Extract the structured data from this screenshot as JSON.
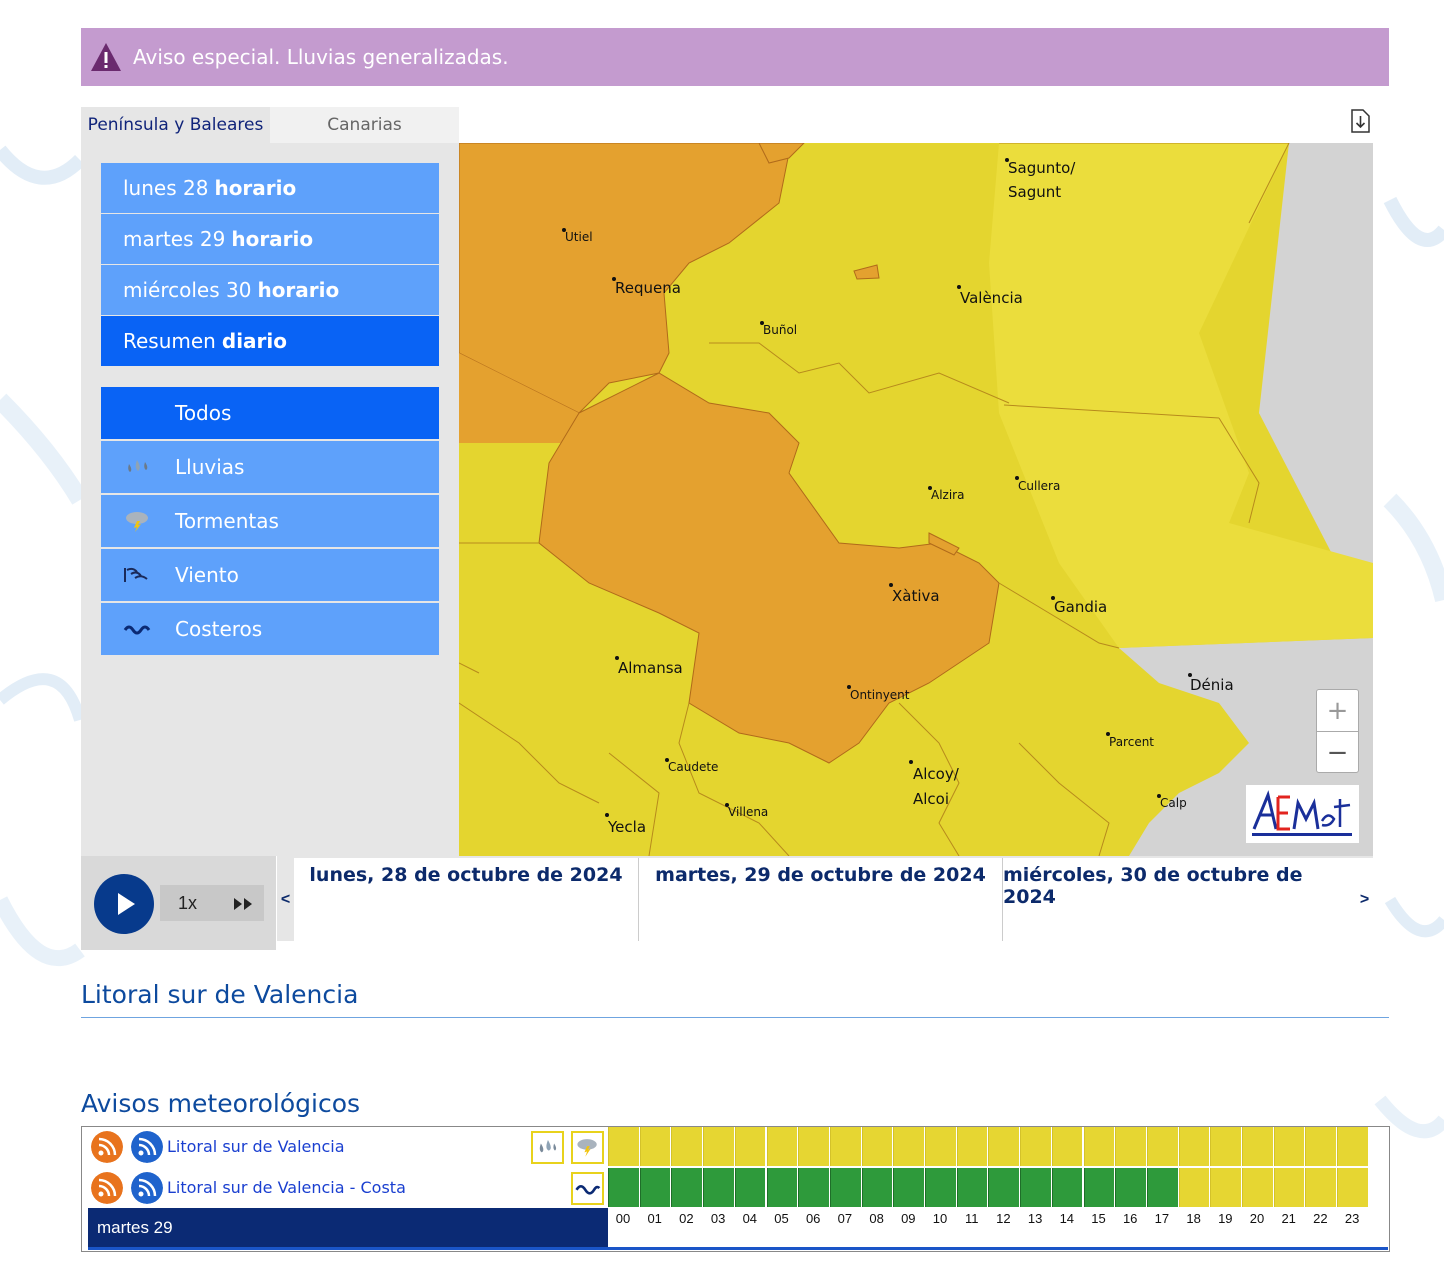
{
  "alert": {
    "text": "Aviso especial. Lluvias generalizadas."
  },
  "tabs": [
    {
      "label": "Península y Baleares",
      "active": true
    },
    {
      "label": "Canarias",
      "active": false
    }
  ],
  "days": [
    {
      "day": "lunes 28",
      "suffix": "horario"
    },
    {
      "day": "martes 29",
      "suffix": "horario"
    },
    {
      "day": "miércoles 30",
      "suffix": "horario"
    },
    {
      "day": "Resumen",
      "suffix": "diario"
    }
  ],
  "filters": [
    {
      "label": "Todos",
      "icon": ""
    },
    {
      "label": "Lluvias",
      "icon": "rain-icon"
    },
    {
      "label": "Tormentas",
      "icon": "storm-icon"
    },
    {
      "label": "Viento",
      "icon": "wind-icon"
    },
    {
      "label": "Costeros",
      "icon": "waves-icon"
    }
  ],
  "map": {
    "cities": {
      "sagunto": "Sagunto/",
      "sagunt": "Sagunt",
      "utiel": "Utiel",
      "requena": "Requena",
      "valencia": "València",
      "bunol": "Buñol",
      "alzira": "Alzira",
      "cullera": "Cullera",
      "xativa": "Xàtiva",
      "gandia": "Gandia",
      "almansa": "Almansa",
      "ontinyent": "Ontinyent",
      "denia": "Dénia",
      "parcent": "Parcent",
      "caudete": "Caudete",
      "alcoy": "Alcoy/",
      "alcoi": "Alcoi",
      "villena": "Villena",
      "calp": "Calp",
      "yecla": "Yecla"
    },
    "zoom_in": "+",
    "zoom_out": "−",
    "logo": "AEMet"
  },
  "colors": {
    "orange": "#e4a12f",
    "yellow": "#e6d632",
    "green": "#2e9a3b",
    "accent": "#0963f5"
  },
  "player": {
    "speed": "1x"
  },
  "timeline": {
    "days": [
      "lunes, 28 de octubre de 2024",
      "martes, 29 de octubre de 2024",
      "miércoles, 30 de octubre de 2024"
    ],
    "prev": "<",
    "next": ">"
  },
  "zone": {
    "title": "Litoral sur de Valencia"
  },
  "warnings": {
    "title": "Avisos meteorológicos",
    "rows": [
      {
        "name": "Litoral sur de Valencia",
        "icons": [
          "rain-icon",
          "storm-icon"
        ],
        "levels": [
          "yellow",
          "yellow",
          "yellow",
          "yellow",
          "yellow",
          "yellow",
          "yellow",
          "yellow",
          "yellow",
          "yellow",
          "yellow",
          "yellow",
          "yellow",
          "yellow",
          "yellow",
          "yellow",
          "yellow",
          "yellow",
          "yellow",
          "yellow",
          "yellow",
          "yellow",
          "yellow",
          "yellow"
        ]
      },
      {
        "name": "Litoral sur de Valencia - Costa",
        "icons": [
          "waves-icon"
        ],
        "levels": [
          "green",
          "green",
          "green",
          "green",
          "green",
          "green",
          "green",
          "green",
          "green",
          "green",
          "green",
          "green",
          "green",
          "green",
          "green",
          "green",
          "green",
          "green",
          "yellow",
          "yellow",
          "yellow",
          "yellow",
          "yellow",
          "yellow"
        ]
      }
    ],
    "day_label": "martes 29",
    "hours": [
      "00",
      "01",
      "02",
      "03",
      "04",
      "05",
      "06",
      "07",
      "08",
      "09",
      "10",
      "11",
      "12",
      "13",
      "14",
      "15",
      "16",
      "17",
      "18",
      "19",
      "20",
      "21",
      "22",
      "23"
    ]
  }
}
